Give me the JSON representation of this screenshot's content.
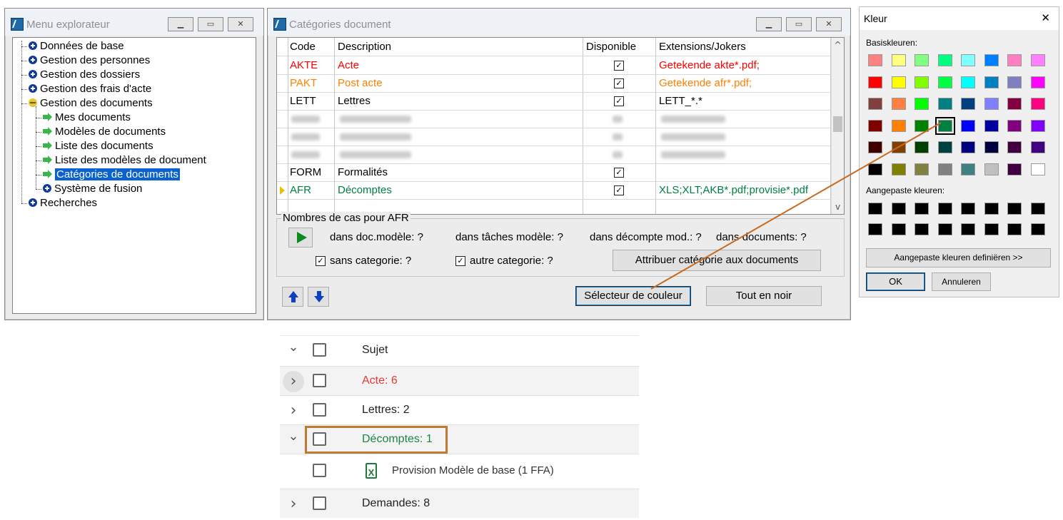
{
  "menu_window": {
    "title": "Menu explorateur",
    "tree": [
      {
        "label": "Données de base",
        "icon": "plus-icon",
        "level": 0
      },
      {
        "label": "Gestion des personnes",
        "icon": "plus-icon",
        "level": 0
      },
      {
        "label": "Gestion des dossiers",
        "icon": "plus-icon",
        "level": 0
      },
      {
        "label": "Gestion des frais d'acte",
        "icon": "plus-icon",
        "level": 0
      },
      {
        "label": "Gestion des documents",
        "icon": "minus-icon",
        "level": 0
      },
      {
        "label": "Mes documents",
        "icon": "arrow-icon",
        "level": 1
      },
      {
        "label": "Modèles de documents",
        "icon": "arrow-icon",
        "level": 1
      },
      {
        "label": "Liste des documents",
        "icon": "arrow-icon",
        "level": 1
      },
      {
        "label": "Liste des modèles de document",
        "icon": "arrow-icon",
        "level": 1
      },
      {
        "label": "Catégories de documents",
        "icon": "arrow-icon",
        "level": 1,
        "selected": true
      },
      {
        "label": "Système de fusion",
        "icon": "plus-icon",
        "level": 1
      },
      {
        "label": "Recherches",
        "icon": "plus-icon",
        "level": 0
      }
    ]
  },
  "categories_window": {
    "title": "Catégories document",
    "columns": [
      "Code",
      "Description",
      "Disponible",
      "Extensions/Jokers"
    ],
    "rows": [
      {
        "code": "AKTE",
        "description": "Acte",
        "available": true,
        "ext": "Getekende akte*.pdf;",
        "color": "#ff0000"
      },
      {
        "code": "PAKT",
        "description": "Post acte",
        "available": true,
        "ext": "Getekende afr*.pdf;",
        "color": "#ff8000"
      },
      {
        "code": "LETT",
        "description": "Lettres",
        "available": true,
        "ext": "LETT_*.*",
        "color": "#000000"
      },
      {
        "code": "",
        "description": "",
        "available": null,
        "ext": "",
        "blurred": true
      },
      {
        "code": "",
        "description": "",
        "available": null,
        "ext": "",
        "blurred": true
      },
      {
        "code": "",
        "description": "",
        "available": null,
        "ext": "",
        "blurred": true
      },
      {
        "code": "FORM",
        "description": "Formalités",
        "available": true,
        "ext": "",
        "color": "#000000"
      },
      {
        "code": "AFR",
        "description": "Décomptes",
        "available": true,
        "ext": "XLS;XLT;AKB*.pdf;provisie*.pdf",
        "color": "#008040",
        "current": true
      }
    ],
    "cases_group": {
      "legend": "Nombres de cas pour AFR",
      "in_model": "dans doc.modèle: ?",
      "in_tasks": "dans tâches modèle: ?",
      "in_decompte": "dans décompte mod.: ?",
      "in_documents": "dans documents: ?",
      "without_category": "sans categorie: ?",
      "other_category": "autre categorie: ?",
      "assign_button": "Attribuer catégorie aux documents"
    },
    "color_selector_button": "Sélecteur de couleur",
    "all_black_button": "Tout en noir"
  },
  "color_dialog": {
    "title": "Kleur",
    "close": "✕",
    "basic_label": "Basiskleuren:",
    "basic_colors": [
      "#ff8080",
      "#ffff80",
      "#80ff80",
      "#00ff80",
      "#80ffff",
      "#0080ff",
      "#ff80c0",
      "#ff80ff",
      "#ff0000",
      "#ffff00",
      "#80ff00",
      "#00ff40",
      "#00ffff",
      "#0080c0",
      "#8080c0",
      "#ff00ff",
      "#804040",
      "#ff8040",
      "#00ff00",
      "#008080",
      "#004080",
      "#8080ff",
      "#800040",
      "#ff0080",
      "#800000",
      "#ff8000",
      "#008000",
      "#008040",
      "#0000ff",
      "#0000a0",
      "#800080",
      "#8000ff",
      "#400000",
      "#804000",
      "#004000",
      "#004040",
      "#000080",
      "#000040",
      "#400040",
      "#400080",
      "#000000",
      "#808000",
      "#808040",
      "#808080",
      "#408080",
      "#c0c0c0",
      "#400040",
      "#ffffff"
    ],
    "selected_index": 27,
    "custom_label": "Aangepaste kleuren:",
    "define_button": "Aangepaste kleuren definiëren >>",
    "ok_button": "OK",
    "cancel_button": "Annuleren"
  },
  "bottom_list": {
    "rows": [
      {
        "label": "Sujet",
        "chevron": "⌄",
        "color": "#202124"
      },
      {
        "label": "Acte: 6",
        "chevron": "›",
        "color": "#e53935"
      },
      {
        "label": "Lettres: 2",
        "chevron": "›",
        "color": "#202124"
      },
      {
        "label": "Décomptes: 1",
        "chevron": "⌄",
        "color": "#1e8449"
      },
      {
        "label": "Provision Modèle de base (1 FFA)",
        "chevron": "",
        "color": "#333333",
        "file": true
      },
      {
        "label": "Demandes: 8",
        "chevron": "›",
        "color": "#202124"
      }
    ]
  }
}
